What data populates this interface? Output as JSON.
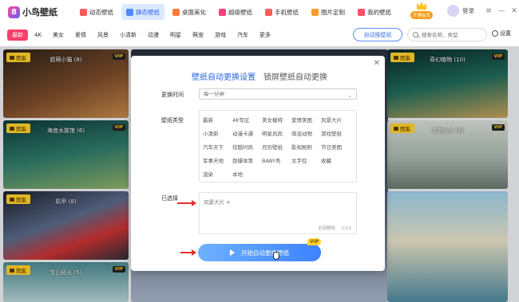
{
  "app": {
    "logo_mark": "8",
    "name": "小鸟壁纸"
  },
  "topnav": [
    {
      "label": "动态壁纸",
      "color": "#ff5a5a",
      "active": false
    },
    {
      "label": "静态壁纸",
      "color": "#4f8bff",
      "active": true
    },
    {
      "label": "桌面美化",
      "color": "#ff7a3d",
      "active": false
    },
    {
      "label": "超级壁纸",
      "color": "#ff3d7f",
      "active": false
    },
    {
      "label": "手机壁纸",
      "color": "#ff5a5a",
      "active": false
    },
    {
      "label": "图片定制",
      "color": "#ff9b2d",
      "active": false
    },
    {
      "label": "我的壁纸",
      "color": "#ff4f6a",
      "active": false
    }
  ],
  "vip": {
    "label": "开通会员"
  },
  "user": {
    "login": "登录"
  },
  "window": {
    "menu": "≡",
    "minimize": "—",
    "close": "✕"
  },
  "categories": [
    "最新",
    "4K",
    "美女",
    "爱情",
    "风景",
    "小清新",
    "动漫",
    "明星",
    "萌宠",
    "游戏",
    "汽车",
    "更多"
  ],
  "toolbar": {
    "auto_change": "自动换壁纸",
    "search_placeholder": "搜索名称、类型",
    "settings": "设置"
  },
  "tiles": [
    {
      "tag": "图集",
      "name": "超萌小猫 (8)",
      "vip": "VIP"
    },
    {
      "tag": "图集",
      "name": "海底水族馆 (6)",
      "vip": "VIP"
    },
    {
      "tag": "图集",
      "name": "机甲 (8)",
      "vip": ""
    },
    {
      "tag": "图集",
      "name": "雪山极光 (5)",
      "vip": "VIP"
    },
    {
      "tag": "图集",
      "name": "奇幻植物 (10)",
      "vip": "VIP"
    },
    {
      "tag": "图集",
      "name": "江南水乡 (6)",
      "vip": "VIP"
    },
    {
      "tag": "",
      "name": "",
      "vip": ""
    }
  ],
  "modal": {
    "tabs": [
      "壁纸自动更换设置",
      "锁屏壁纸自动更换"
    ],
    "close": "✕",
    "time_label": "更换时间",
    "time_value": "每一分钟",
    "types_label": "壁纸类型",
    "types": [
      "最新",
      "4K专区",
      "美女模特",
      "爱情美图",
      "风景大片",
      "小清新",
      "动漫卡通",
      "明星风尚",
      "萌宠动物",
      "游戏壁纸",
      "汽车天下",
      "炫酷时尚",
      "月历壁纸",
      "影视剧照",
      "节日美图",
      "军事天地",
      "劲爆体育",
      "BABY秀",
      "文字控",
      "收藏",
      "渲染",
      "本地"
    ],
    "selected_label": "已选择",
    "selected_chip": "风景大片 ✕",
    "clear_all": "全部删除",
    "count": "1/10",
    "start_button": "开始自动更换壁纸",
    "start_vip": "VIP"
  }
}
